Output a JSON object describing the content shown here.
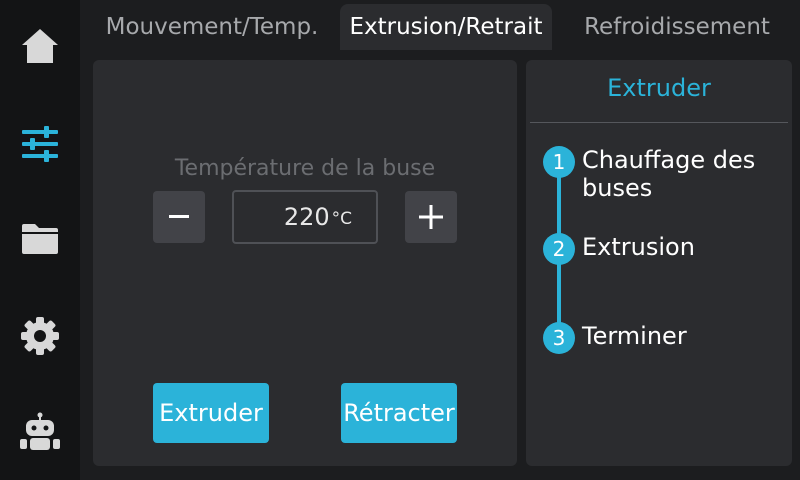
{
  "colors": {
    "accent": "#2bb3d9",
    "background": "#1c1d1f",
    "sidebar": "#131415",
    "panel": "#2b2c2f",
    "icon_inactive": "#d8d8d8"
  },
  "sidebar": {
    "items": [
      {
        "icon": "home-icon",
        "active": false
      },
      {
        "icon": "sliders-icon",
        "active": true
      },
      {
        "icon": "folder-icon",
        "active": false
      },
      {
        "icon": "gear-icon",
        "active": false
      },
      {
        "icon": "robot-icon",
        "active": false
      }
    ]
  },
  "tabs": [
    {
      "label": "Mouvement/Temp.",
      "active": false
    },
    {
      "label": "Extrusion/Retrait",
      "active": true
    },
    {
      "label": "Refroidissement",
      "active": false
    }
  ],
  "extrusion": {
    "temp_label": "Température de la buse",
    "decrease_symbol": "−",
    "increase_symbol": "+",
    "temp_value": "220",
    "temp_unit": "°C",
    "extrude_label": "Extruder",
    "retract_label": "Rétracter"
  },
  "steps": {
    "title": "Extruder",
    "items": [
      {
        "num": "1",
        "label": "Chauffage des buses"
      },
      {
        "num": "2",
        "label": "Extrusion"
      },
      {
        "num": "3",
        "label": "Terminer"
      }
    ]
  }
}
